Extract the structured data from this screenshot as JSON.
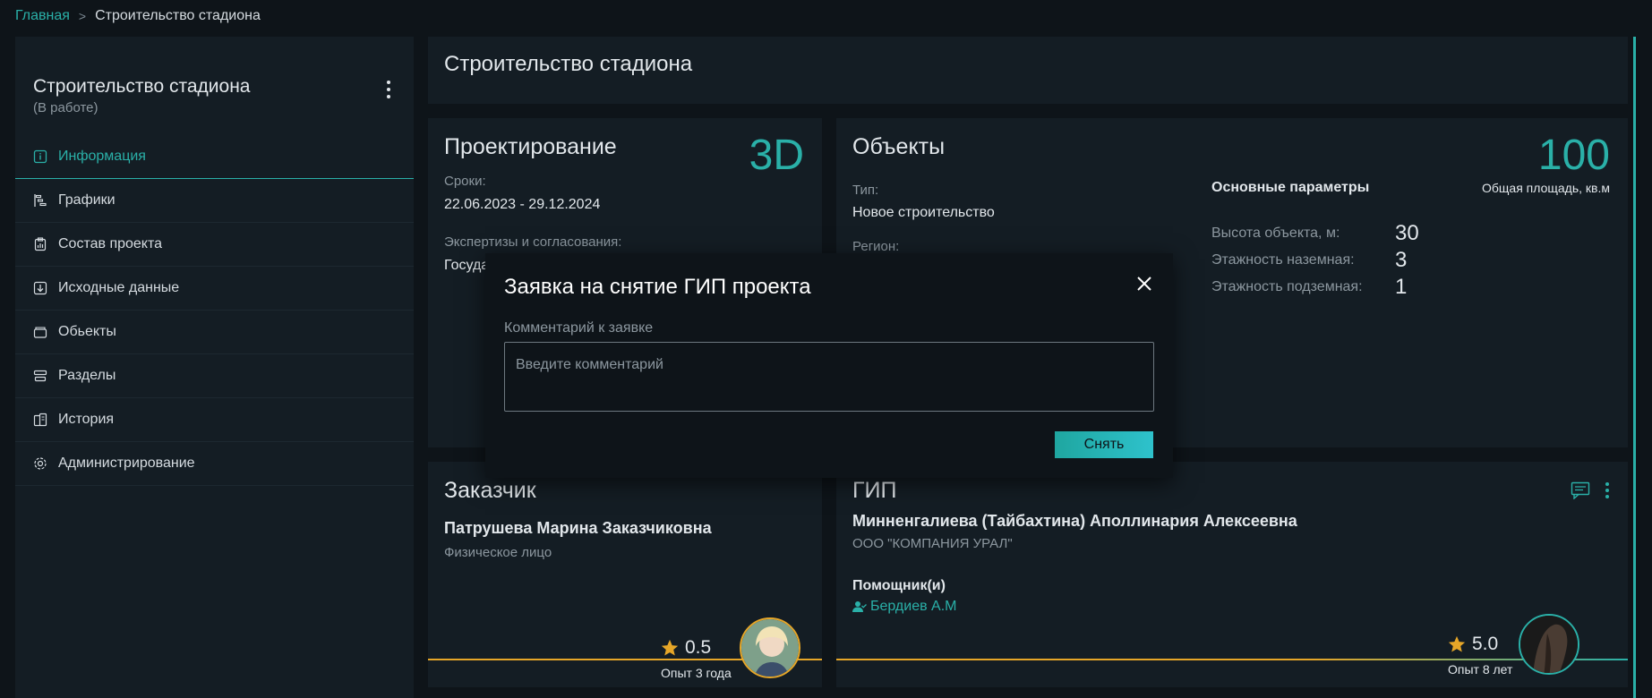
{
  "breadcrumb": {
    "home": "Главная",
    "separator": ">",
    "current": "Строительство стадиона"
  },
  "sidebar": {
    "project_title": "Строительство стадиона",
    "project_status": "(В работе)",
    "items": [
      {
        "label": "Информация",
        "icon": "info-icon",
        "active": true
      },
      {
        "label": "Графики",
        "icon": "gantt-icon",
        "active": false
      },
      {
        "label": "Состав проекта",
        "icon": "clipboard-icon",
        "active": false
      },
      {
        "label": "Исходные данные",
        "icon": "download-icon",
        "active": false
      },
      {
        "label": "Обьекты",
        "icon": "box-icon",
        "active": false
      },
      {
        "label": "Разделы",
        "icon": "layers-icon",
        "active": false
      },
      {
        "label": "История",
        "icon": "history-icon",
        "active": false
      },
      {
        "label": "Администрирование",
        "icon": "gear-icon",
        "active": false
      }
    ]
  },
  "main": {
    "title": "Строительство стадиона"
  },
  "projecting": {
    "title": "Проектирование",
    "badge": "3D",
    "dates_label": "Сроки:",
    "dates_value": "22.06.2023 - 29.12.2024",
    "expertise_label": "Экспертизы и согласования:",
    "expertise_value_partial": "Госуда"
  },
  "objects": {
    "title": "Объекты",
    "area_value": "100",
    "area_label": "Общая площадь, кв.м",
    "type_label": "Тип:",
    "type_value": "Новое строительство",
    "region_label": "Регион:",
    "params_title": "Основные параметры",
    "params": [
      {
        "label": "Высота объекта, м:",
        "value": "30"
      },
      {
        "label": "Этажность наземная:",
        "value": "3"
      },
      {
        "label": "Этажность подземная:",
        "value": "1"
      }
    ]
  },
  "customer": {
    "title": "Заказчик",
    "name": "Патрушева Марина Заказчиковна",
    "type": "Физическое лицо",
    "rating": "0.5",
    "experience": "Опыт 3 года"
  },
  "gip": {
    "title": "ГИП",
    "name": "Минненгалиева (Тайбахтина) Аполлинария Алексеевна",
    "company": "ООО \"КОМПАНИЯ УРАЛ\"",
    "assistants_label": "Помощник(и)",
    "assistant": "Бердиев А.М",
    "rating": "5.0",
    "experience": "Опыт 8 лет"
  },
  "modal": {
    "title": "Заявка на снятие ГИП проекта",
    "comment_label": "Комментарий к заявке",
    "comment_placeholder": "Введите комментарий",
    "comment_value": "",
    "submit_label": "Снять"
  },
  "colors": {
    "accent": "#2ab0a8",
    "gold": "#e6a628",
    "bg": "#0e1419",
    "card": "#141d24"
  }
}
